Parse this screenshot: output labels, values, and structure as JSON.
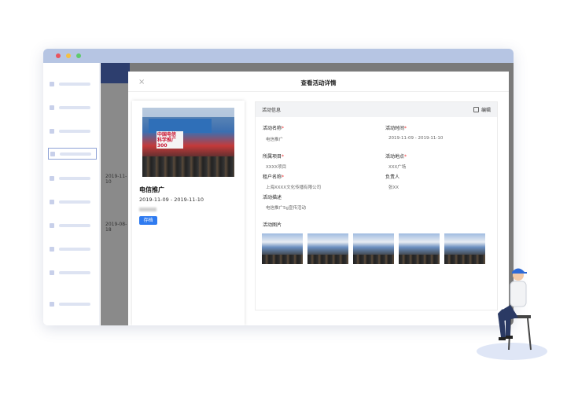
{
  "window": {
    "dots": [
      {
        "name": "close-dot",
        "color": "#e9545e"
      },
      {
        "name": "minimize-dot",
        "color": "#f5c042"
      },
      {
        "name": "maximize-dot",
        "color": "#5fca6c"
      }
    ]
  },
  "background": {
    "dates": [
      "2019-11-10",
      "2019-08-18"
    ]
  },
  "drawer": {
    "title": "查看活动详情",
    "close_glyph": "×"
  },
  "card": {
    "name": "电信推广",
    "date": "2019-11-09 - 2019-11-10",
    "banner": "中国电信 科学推广 300",
    "archive_label": "存档"
  },
  "info": {
    "header": "活动信息",
    "edit_label": "编辑",
    "fields": {
      "name_label": "活动名称",
      "name_value": "电信推广",
      "time_label": "活动时间",
      "time_value": "2019-11-09 - 2019-11-10",
      "project_label": "所属项目",
      "project_value": "XXXX项目",
      "location_label": "活动地点",
      "location_value": "XXX广场",
      "tenant_label": "租户名称",
      "tenant_value": "上海XXXX文化传播有限公司",
      "owner_label": "负责人",
      "owner_value": "张XX",
      "desc_label": "活动描述",
      "desc_value": "电信推广5g宣传活动",
      "photos_label": "活动图片"
    },
    "required_mark": "*"
  },
  "colors": {
    "titlebar": "#b6c5e3",
    "primary_button": "#2f7bf0",
    "required": "#e33333"
  }
}
